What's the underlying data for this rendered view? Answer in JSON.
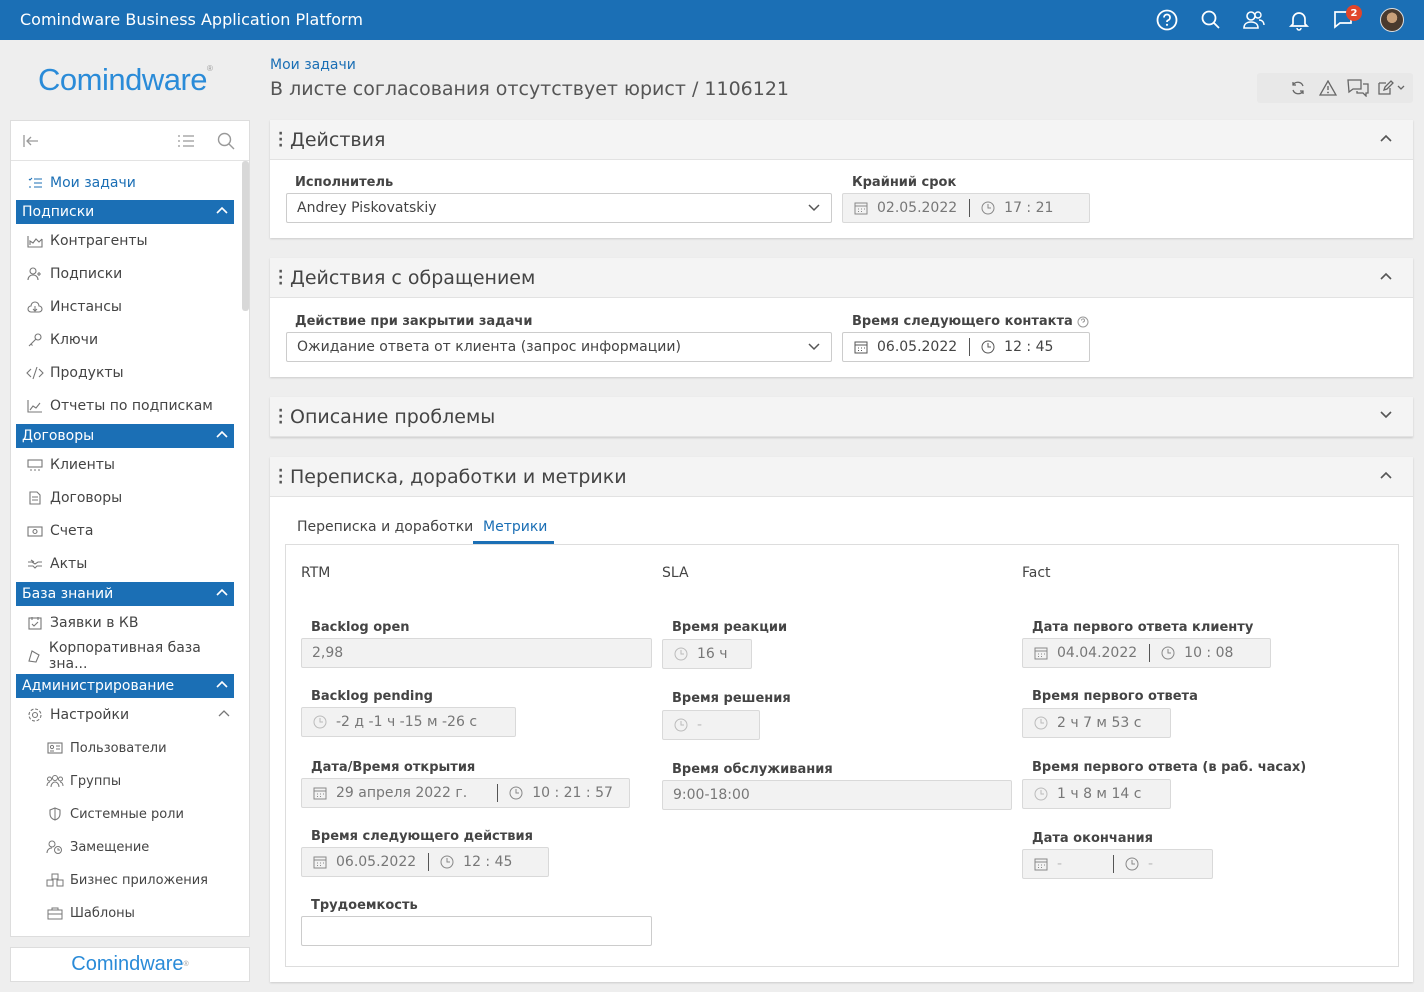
{
  "app": {
    "title": "Comindware Business Application Platform",
    "notification_count": "2"
  },
  "logo": {
    "text_prefix": "Com",
    "text_i": "i",
    "text_suffix": "ndware",
    "reg": "®"
  },
  "bottom_logo": {
    "text": "Comindware",
    "reg": "®"
  },
  "header": {
    "breadcrumb": "Мои задачи",
    "title": "В листе согласования отсутствует юрист / 1106121"
  },
  "sidebar": {
    "my_tasks": "Мои задачи",
    "sections": [
      {
        "label": "Подписки",
        "items": [
          "Контрагенты",
          "Подписки",
          "Инстансы",
          "Ключи",
          "Продукты",
          "Отчеты по подпискам"
        ]
      },
      {
        "label": "Договоры",
        "items": [
          "Клиенты",
          "Договоры",
          "Счета",
          "Акты"
        ]
      },
      {
        "label": "База знаний",
        "items": [
          "Заявки в КВ",
          "Корпоративная база зна..."
        ]
      },
      {
        "label": "Администрирование",
        "items": [
          "Настройки"
        ]
      }
    ],
    "settings_sub": [
      "Пользователи",
      "Группы",
      "Системные роли",
      "Замещение",
      "Бизнес приложения",
      "Шаблоны"
    ]
  },
  "panels": {
    "actions": {
      "title": "Действия",
      "assignee_label": "Исполнитель",
      "assignee_value": "Andrey Piskovatskiy",
      "deadline_label": "Крайний срок",
      "deadline_date": "02.05.2022",
      "deadline_time": "17 : 21"
    },
    "request_actions": {
      "title": "Действия с обращением",
      "close_action_label": "Действие при закрытии задачи",
      "close_action_value": "Ожидание ответа от клиента (запрос информации)",
      "next_contact_label": "Время следующего контакта",
      "next_contact_date": "06.05.2022",
      "next_contact_time": "12 : 45"
    },
    "problem": {
      "title": "Описание проблемы"
    },
    "metrics": {
      "title": "Переписка, доработки и метрики",
      "tabs": [
        "Переписка и доработки",
        "Метрики"
      ],
      "col_rtm": "RTM",
      "col_sla": "SLA",
      "col_fact": "Fact",
      "backlog_open_label": "Backlog open",
      "backlog_open_value": "2,98",
      "backlog_pending_label": "Backlog pending",
      "backlog_pending_value": "-2 д -1 ч -15 м -26 с",
      "open_dt_label": "Дата/Время открытия",
      "open_dt_date": "29 апреля 2022 г.",
      "open_dt_time": "10 : 21 : 57",
      "next_action_label": "Время следующего действия",
      "next_action_date": "06.05.2022",
      "next_action_time": "12 : 45",
      "effort_label": "Трудоемкость",
      "effort_value": "",
      "reaction_label": "Время реакции",
      "reaction_value": "16 ч",
      "resolution_label": "Время решения",
      "resolution_value": "-",
      "service_label": "Время обслуживания",
      "service_value": "9:00-18:00",
      "first_reply_date_label": "Дата первого ответа клиенту",
      "first_reply_date": "04.04.2022",
      "first_reply_time": "10 : 08",
      "first_reply_label": "Время первого ответа",
      "first_reply_value": "2 ч 7 м 53 с",
      "first_reply_work_label": "Время первого ответа (в раб. часах)",
      "first_reply_work_value": "1 ч 8 м 14 с",
      "end_date_label": "Дата окончания",
      "end_date": "-",
      "end_time": "-"
    }
  },
  "colors": {
    "brand": "#1b6fb5",
    "badge": "#e0452b"
  }
}
